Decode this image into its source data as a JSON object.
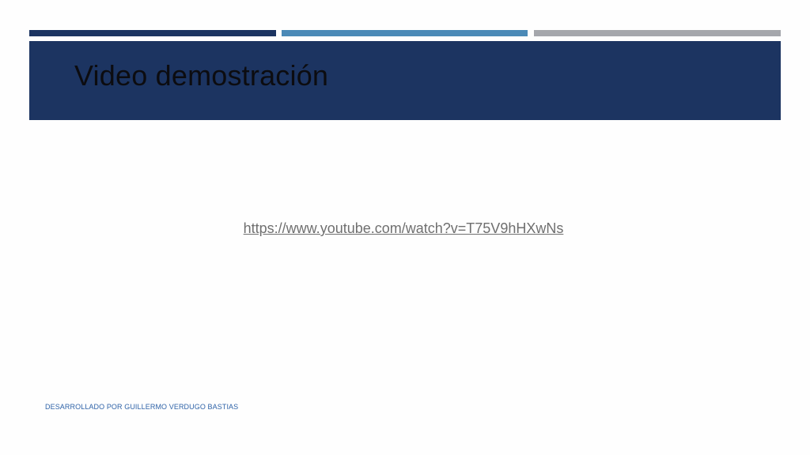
{
  "slide": {
    "title": "Video demostración",
    "link_text": "https://www.youtube.com/watch?v=T75V9hHXwNs",
    "footer": "DESARROLLADO POR GUILLERMO VERDUGO BASTIAS"
  },
  "colors": {
    "background": "#fefefe",
    "banner": "#1c3461",
    "title_text": "#0c0c10",
    "accent_dark_blue": "#1c3461",
    "accent_mid_blue": "#4b8ab7",
    "accent_gray": "#a5a7ac",
    "link": "#6f6f6f",
    "footer_text": "#2f63a8"
  }
}
